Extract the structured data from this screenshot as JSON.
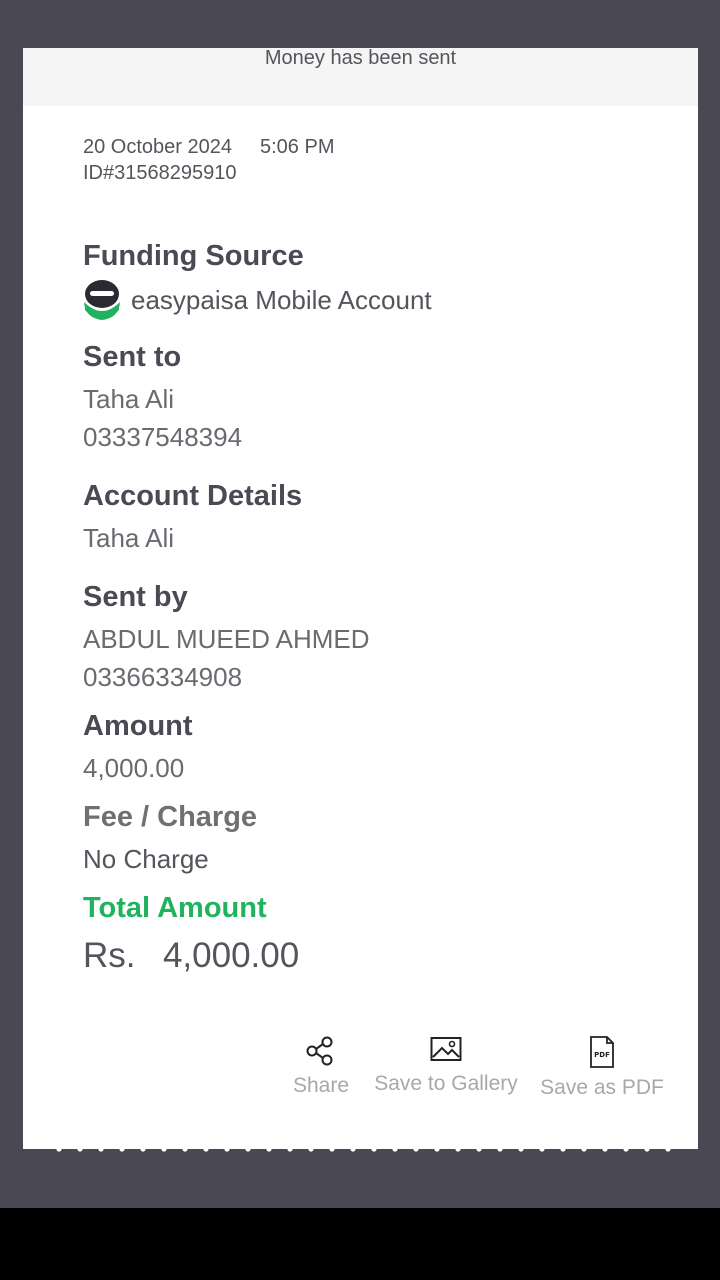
{
  "header": {
    "title": "Money has been sent"
  },
  "meta": {
    "date": "20 October 2024",
    "time": "5:06 PM",
    "transaction_id": "ID#31568295910"
  },
  "funding_source": {
    "label": "Funding Source",
    "value": "easypaisa Mobile Account",
    "icon": "easypaisa-logo-icon"
  },
  "sent_to": {
    "label": "Sent to",
    "name": "Taha Ali",
    "number": "03337548394"
  },
  "account_details": {
    "label": "Account Details",
    "value": "Taha Ali"
  },
  "sent_by": {
    "label": "Sent by",
    "name": "ABDUL MUEED AHMED",
    "number": "03366334908"
  },
  "amount": {
    "label": "Amount",
    "value": "4,000.00"
  },
  "fee": {
    "label": "Fee / Charge",
    "value": "No Charge"
  },
  "total": {
    "label": "Total Amount",
    "currency": "Rs.",
    "value": "4,000.00"
  },
  "actions": [
    {
      "label": "Share",
      "icon": "share-icon"
    },
    {
      "label": "Save to Gallery",
      "icon": "image-icon"
    },
    {
      "label": "Save as PDF",
      "icon": "pdf-file-icon",
      "icon_text": "PDF"
    }
  ],
  "colors": {
    "background": "#4a4854",
    "card": "#ffffff",
    "header_band": "#f5f5f5",
    "accent_green": "#20b35f",
    "label_dark": "#4a4954",
    "action_text": "#a8a8ac"
  }
}
